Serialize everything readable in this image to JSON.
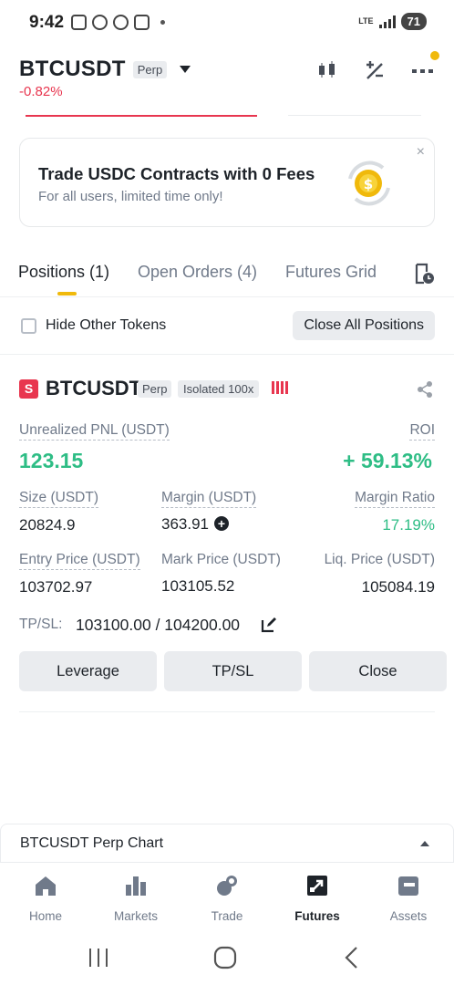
{
  "status_bar": {
    "time": "9:42",
    "network": "LTE",
    "battery": "71"
  },
  "header": {
    "symbol": "BTCUSDT",
    "contract_tag": "Perp",
    "change": "-0.82%",
    "icons": [
      "candlestick-chart-icon",
      "calculator-icon",
      "more-icon"
    ]
  },
  "promo": {
    "title": "Trade USDC Contracts with 0 Fees",
    "subtitle": "For all users, limited time only!",
    "close": "×"
  },
  "tabs": [
    {
      "label": "Positions (1)",
      "active": true
    },
    {
      "label": "Open Orders (4)",
      "active": false
    },
    {
      "label": "Futures Grid",
      "active": false
    }
  ],
  "filter": {
    "hide_other_tokens": "Hide Other Tokens",
    "hide_other_tokens_checked": false,
    "close_all": "Close All Positions"
  },
  "position": {
    "side_badge": "S",
    "symbol": "BTCUSDT",
    "contract_tag": "Perp",
    "margin_mode": "Isolated 100x",
    "unrealized_pnl_label": "Unrealized PNL (USDT)",
    "unrealized_pnl": "123.15",
    "roi_label": "ROI",
    "roi": "+ 59.13%",
    "size_label": "Size (USDT)",
    "size": "20824.9",
    "margin_label": "Margin (USDT)",
    "margin": "363.91",
    "margin_ratio_label": "Margin Ratio",
    "margin_ratio": "17.19%",
    "entry_price_label": "Entry Price (USDT)",
    "entry_price": "103702.97",
    "mark_price_label": "Mark Price (USDT)",
    "mark_price": "103105.52",
    "liq_price_label": "Liq. Price (USDT)",
    "liq_price": "105084.19",
    "tpsl_label": "TP/SL:",
    "tpsl_value": "103100.00 / 104200.00",
    "buttons": {
      "leverage": "Leverage",
      "tpsl": "TP/SL",
      "close": "Close"
    }
  },
  "chart_panel": {
    "label": "BTCUSDT Perp Chart"
  },
  "bottom_nav": [
    {
      "label": "Home",
      "icon": "home-icon",
      "active": false
    },
    {
      "label": "Markets",
      "icon": "markets-icon",
      "active": false
    },
    {
      "label": "Trade",
      "icon": "trade-icon",
      "active": false
    },
    {
      "label": "Futures",
      "icon": "futures-icon",
      "active": true
    },
    {
      "label": "Assets",
      "icon": "assets-icon",
      "active": false
    }
  ],
  "colors": {
    "accent": "#f0b90b",
    "positive": "#2ebd85",
    "negative": "#e8364f",
    "text": "#1e2329",
    "muted": "#707a8a"
  }
}
